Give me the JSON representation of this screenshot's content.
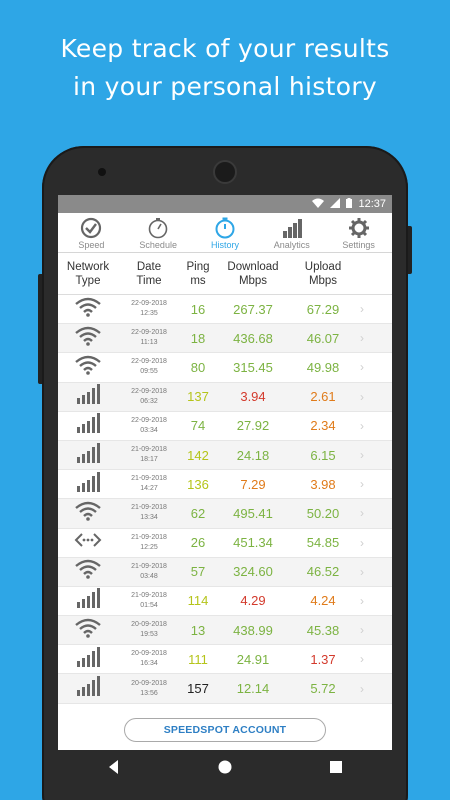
{
  "headline": {
    "line1": "Keep track of your results",
    "line2": "in your personal history"
  },
  "status": {
    "time": "12:37"
  },
  "tabs": [
    {
      "label": "Speed",
      "icon": "speedometer-icon"
    },
    {
      "label": "Schedule",
      "icon": "stopwatch-icon"
    },
    {
      "label": "History",
      "icon": "timer-icon",
      "active": true
    },
    {
      "label": "Analytics",
      "icon": "bar-chart-icon"
    },
    {
      "label": "Settings",
      "icon": "gear-icon"
    }
  ],
  "columns": {
    "network": [
      "Network",
      "Type"
    ],
    "datetime": [
      "Date",
      "Time"
    ],
    "ping": [
      "Ping",
      "ms"
    ],
    "download": [
      "Download",
      "Mbps"
    ],
    "upload": [
      "Upload",
      "Mbps"
    ]
  },
  "rows": [
    {
      "type": "wifi",
      "date": "22-09-2018",
      "time": "12:35",
      "ping": "16",
      "download": "267.37",
      "upload": "67.29"
    },
    {
      "type": "wifi",
      "date": "22-09-2018",
      "time": "11:13",
      "ping": "18",
      "download": "436.68",
      "upload": "46.07"
    },
    {
      "type": "wifi",
      "date": "22-09-2018",
      "time": "09:55",
      "ping": "80",
      "download": "315.45",
      "upload": "49.98"
    },
    {
      "type": "cellular",
      "date": "22-09-2018",
      "time": "06:32",
      "ping": "137",
      "download": "3.94",
      "upload": "2.61"
    },
    {
      "type": "cellular",
      "date": "22-09-2018",
      "time": "03:34",
      "ping": "74",
      "download": "27.92",
      "upload": "2.34"
    },
    {
      "type": "cellular",
      "date": "21-09-2018",
      "time": "18:17",
      "ping": "142",
      "download": "24.18",
      "upload": "6.15"
    },
    {
      "type": "cellular",
      "date": "21-09-2018",
      "time": "14:27",
      "ping": "136",
      "download": "7.29",
      "upload": "3.98"
    },
    {
      "type": "wifi",
      "date": "21-09-2018",
      "time": "13:34",
      "ping": "62",
      "download": "495.41",
      "upload": "50.20"
    },
    {
      "type": "ethernet",
      "date": "21-09-2018",
      "time": "12:25",
      "ping": "26",
      "download": "451.34",
      "upload": "54.85"
    },
    {
      "type": "wifi",
      "date": "21-09-2018",
      "time": "03:48",
      "ping": "57",
      "download": "324.60",
      "upload": "46.52"
    },
    {
      "type": "cellular",
      "date": "21-09-2018",
      "time": "01:54",
      "ping": "114",
      "download": "4.29",
      "upload": "4.24"
    },
    {
      "type": "wifi",
      "date": "20-09-2018",
      "time": "19:53",
      "ping": "13",
      "download": "438.99",
      "upload": "45.38"
    },
    {
      "type": "cellular",
      "date": "20-09-2018",
      "time": "16:34",
      "ping": "111",
      "download": "24.91",
      "upload": "1.37"
    },
    {
      "type": "cellular",
      "date": "20-09-2018",
      "time": "13:56",
      "ping": "157",
      "download": "12.14",
      "upload": "5.72"
    }
  ],
  "account_button": "SPEEDSPOT ACCOUNT",
  "colors": {
    "background": "#2ea6e6",
    "accent": "#2ea6e6",
    "good": "#7cb342",
    "fair": "#b5c41a",
    "warn": "#e07b1a",
    "bad": "#d33a2c"
  }
}
